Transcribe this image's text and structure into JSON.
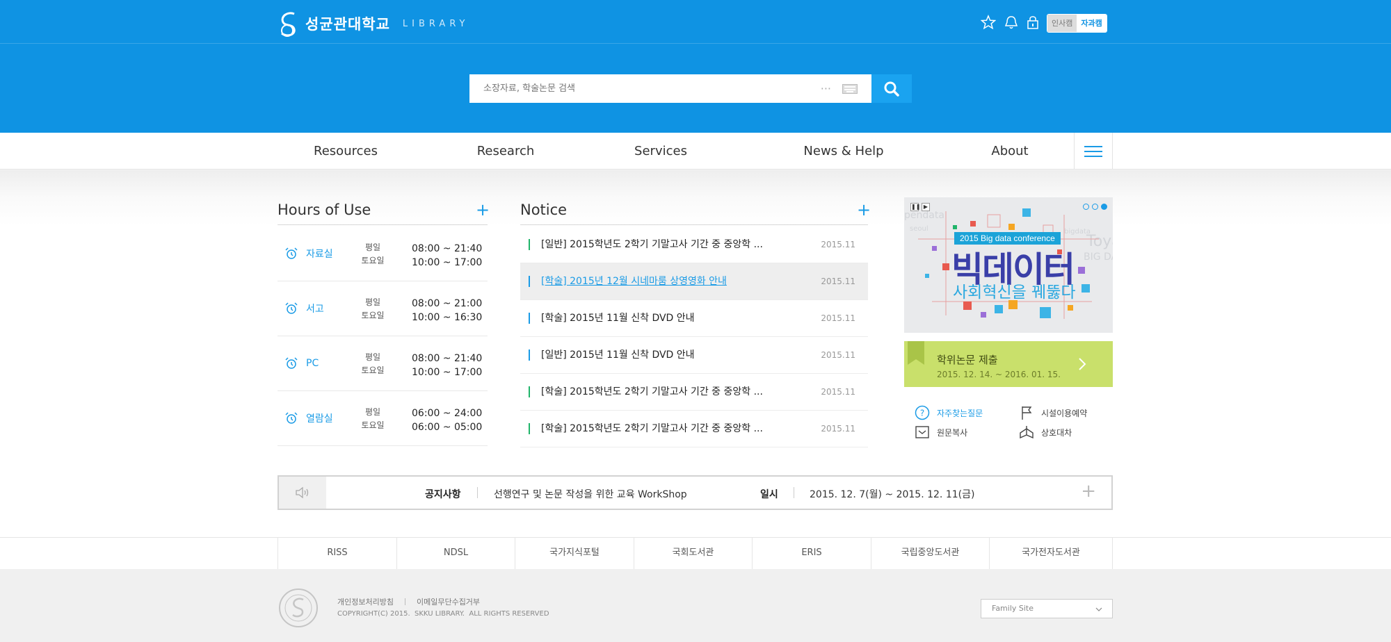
{
  "header": {
    "logo_text": "성균관대학교",
    "logo_sub": "LIBRARY",
    "campus_tabs": [
      "인사캠",
      "자과캠"
    ],
    "search_placeholder": "소장자료, 학술논문 검색"
  },
  "nav": {
    "items": [
      "Resources",
      "Research",
      "Services",
      "News & Help",
      "About"
    ]
  },
  "hours": {
    "title": "Hours of Use",
    "rows": [
      {
        "name": "자료실",
        "day1": "평일",
        "day2": "토요일",
        "time1": "08:00 ~ 21:40",
        "time2": "10:00 ~ 17:00"
      },
      {
        "name": "서고",
        "day1": "평일",
        "day2": "토요일",
        "time1": "08:00 ~ 21:00",
        "time2": "10:00 ~ 16:30"
      },
      {
        "name": "PC",
        "day1": "평일",
        "day2": "토요일",
        "time1": "08:00 ~ 21:40",
        "time2": "10:00 ~ 17:00"
      },
      {
        "name": "열람실",
        "day1": "평일",
        "day2": "토요일",
        "time1": "06:00 ~ 24:00",
        "time2": "06:00 ~ 05:00"
      }
    ]
  },
  "notice": {
    "title": "Notice",
    "items": [
      {
        "text": "[일반] 2015학년도 2학기 기말고사 기간 중 중앙학 ...",
        "date": "2015.11"
      },
      {
        "text": "[학술] 2015년 12월 시네마룸 상영영화 안내",
        "date": "2015.11"
      },
      {
        "text": "[학술] 2015년 11월 신착 DVD 안내",
        "date": "2015.11"
      },
      {
        "text": "[일반] 2015년 11월 신착 DVD 안내",
        "date": "2015.11"
      },
      {
        "text": "[학술] 2015학년도 2학기 기말고사 기간 중 중앙학 ...",
        "date": "2015.11"
      },
      {
        "text": "[학술] 2015학년도 2학기 기말고사 기간 중 중앙학 ...",
        "date": "2015.11"
      }
    ]
  },
  "banner": {
    "tag": "2015 Big data conference",
    "title": "빅데이터",
    "subtitle": "사회혁신을 꿰뚫다",
    "bg_words": [
      "pendata",
      "seoul",
      "bigdata",
      "Toya",
      "BIG DA"
    ]
  },
  "thesis": {
    "title": "학위논문 제출",
    "dates": "2015. 12. 14. ~ 2016. 01. 15."
  },
  "quick_links": [
    "자주찾는질문",
    "시설이용예약",
    "원문복사",
    "상호대차"
  ],
  "notice_bar": {
    "label": "공지사항",
    "text": "선행연구 및 논문 작성을 위한 교육 WorkShop",
    "date_label": "일시",
    "date": "2015. 12. 7(월) ~ 2015. 12. 11(금)"
  },
  "footer_links": [
    "RISS",
    "NDSL",
    "국가지식포털",
    "국회도서관",
    "ERIS",
    "국립중앙도서관",
    "국가전자도서관"
  ],
  "footer": {
    "privacy": "개인정보처리방침",
    "email_policy": "이메일무단수집거부",
    "copyright": "COPYRIGHT(C) 2015.  SKKU LIBRARY.  ALL RIGHTS RESERVED",
    "family_site": "Family Site"
  },
  "colors": {
    "brand": "#0f93e3",
    "accent": "#1a9be6",
    "green": "#20b46a",
    "thesis": "#c9e06b"
  }
}
